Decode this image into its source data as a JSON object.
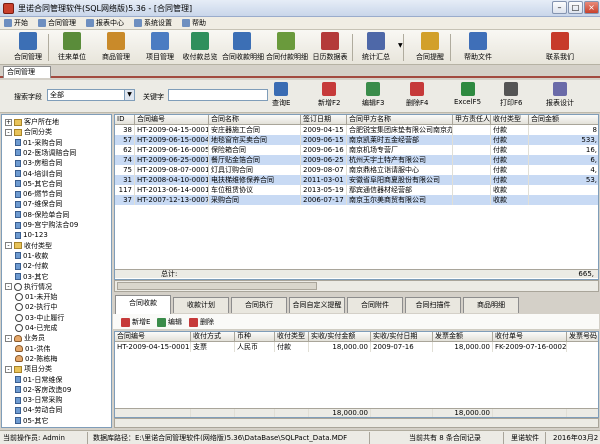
{
  "window": {
    "title": "里诺合同管理软件(SQL网络版)5.36 - [合同管理]",
    "min": "–",
    "max": "□",
    "close": "×"
  },
  "menu": [
    "开始",
    "合同管理",
    "报表中心",
    "系统设置",
    "帮助"
  ],
  "toolbar": [
    {
      "label": "合同管理",
      "color": "#3c6fb5"
    },
    {
      "label": "往来单位",
      "color": "#5a8c3a"
    },
    {
      "label": "商品管理",
      "color": "#c98a2a"
    },
    {
      "label": "项目管理",
      "color": "#4b7cc2"
    },
    {
      "label": "收付款总览",
      "color": "#2f8f5c"
    },
    {
      "label": "合同收款明细",
      "color": "#3c6fb5"
    },
    {
      "label": "合同付款明细",
      "color": "#6a9a3c"
    },
    {
      "label": "日历数据表",
      "color": "#b43a3a"
    },
    {
      "label": "统计汇总",
      "color": "#4e68a8"
    },
    {
      "label": "合同提醒",
      "color": "#d2a02a"
    },
    {
      "label": "帮助文件",
      "color": "#3f6fb8"
    },
    {
      "label": "联系我们",
      "color": "#c73a2a"
    }
  ],
  "doc_tab": "合同管理",
  "search": {
    "field_label": "搜索字段",
    "field_value": "全部",
    "keyword_label": "关键字",
    "keyword_value": "",
    "buttons": [
      {
        "label": "查询E",
        "color": "#3a6cb3"
      },
      {
        "label": "新增F2",
        "color": "#c63a3a"
      },
      {
        "label": "编辑F3",
        "color": "#3a8c4a"
      },
      {
        "label": "删除F4",
        "color": "#c63a3a"
      },
      {
        "label": "ExcelF5",
        "color": "#2e8a40"
      },
      {
        "label": "打印F6",
        "color": "#555555"
      },
      {
        "label": "报表设计",
        "color": "#6a6aa8"
      }
    ]
  },
  "tree": [
    {
      "level": 0,
      "expander": "+",
      "label": "客户所在地",
      "kind": "folder"
    },
    {
      "level": 0,
      "expander": "-",
      "label": "合同分类",
      "kind": "folder"
    },
    {
      "level": 1,
      "expander": "",
      "label": "01-采购合同",
      "kind": "leaf"
    },
    {
      "level": 1,
      "expander": "",
      "label": "02-医场调赔合同",
      "kind": "leaf"
    },
    {
      "level": 1,
      "expander": "",
      "label": "03-房租合同",
      "kind": "leaf"
    },
    {
      "level": 1,
      "expander": "",
      "label": "04-培训合同",
      "kind": "leaf"
    },
    {
      "level": 1,
      "expander": "",
      "label": "05-其它合同",
      "kind": "leaf"
    },
    {
      "level": 1,
      "expander": "",
      "label": "06-燃节合同",
      "kind": "leaf"
    },
    {
      "level": 1,
      "expander": "",
      "label": "07-维保合同",
      "kind": "leaf"
    },
    {
      "level": 1,
      "expander": "",
      "label": "08-保险单合同",
      "kind": "leaf"
    },
    {
      "level": 1,
      "expander": "",
      "label": "09-宫宁购法合09",
      "kind": "leaf"
    },
    {
      "level": 1,
      "expander": "",
      "label": "10-123",
      "kind": "leaf"
    },
    {
      "level": 0,
      "expander": "-",
      "label": "收付类型",
      "kind": "folder"
    },
    {
      "level": 1,
      "expander": "",
      "label": "01-收款",
      "kind": "leaf"
    },
    {
      "level": 1,
      "expander": "",
      "label": "02-付款",
      "kind": "leaf"
    },
    {
      "level": 1,
      "expander": "",
      "label": "03-其它",
      "kind": "leaf"
    },
    {
      "level": 0,
      "expander": "-",
      "label": "执行情况",
      "kind": "clock"
    },
    {
      "level": 1,
      "expander": "",
      "label": "01-未开始",
      "kind": "clock"
    },
    {
      "level": 1,
      "expander": "",
      "label": "02-执行中",
      "kind": "clock"
    },
    {
      "level": 1,
      "expander": "",
      "label": "03-中止履行",
      "kind": "clock"
    },
    {
      "level": 1,
      "expander": "",
      "label": "04-已完成",
      "kind": "clock"
    },
    {
      "level": 0,
      "expander": "-",
      "label": "业务员",
      "kind": "person"
    },
    {
      "level": 1,
      "expander": "",
      "label": "01-洪伟",
      "kind": "person"
    },
    {
      "level": 1,
      "expander": "",
      "label": "02-陈栋梅",
      "kind": "person"
    },
    {
      "level": 0,
      "expander": "-",
      "label": "项目分类",
      "kind": "folder"
    },
    {
      "level": 1,
      "expander": "",
      "label": "01-日常维保",
      "kind": "leaf"
    },
    {
      "level": 1,
      "expander": "",
      "label": "02-客房改造09",
      "kind": "leaf"
    },
    {
      "level": 1,
      "expander": "",
      "label": "03-日常采购",
      "kind": "leaf"
    },
    {
      "level": 1,
      "expander": "",
      "label": "04-劳动合同",
      "kind": "leaf"
    },
    {
      "level": 1,
      "expander": "",
      "label": "05-其它",
      "kind": "leaf"
    }
  ],
  "main_table": {
    "columns": [
      "ID",
      "合同编号",
      "合同名称",
      "签订日期",
      "合同甲方名称",
      "甲方责任人",
      "收付类型",
      "合同金额"
    ],
    "rows": [
      [
        "38",
        "HT-2009-04-15-0001",
        "安庄器施工合同",
        "2009-04-15",
        "合肥锐宝集团床垫有限公司南京办事处",
        "",
        "付款",
        "8"
      ],
      [
        "57",
        "HT-2009-06-15-0004",
        "地毯窗帘买卖合同",
        "2009-06-15",
        "南京凯莱时五金经营部",
        "",
        "付款",
        "533,"
      ],
      [
        "62",
        "HT-2009-06-16-0005",
        "保险箱合同",
        "2009-06-16",
        "南京机场专营厂",
        "",
        "付款",
        "16,"
      ],
      [
        "74",
        "HT-2009-06-25-0001",
        "餐厅贴金箔合同",
        "2009-06-25",
        "杭州天宇土特产有限公司",
        "",
        "付款",
        "6,"
      ],
      [
        "75",
        "HT-2009-08-07-0001",
        "灯具订购合同",
        "2009-08-07",
        "南京鼎格立诣请服中心",
        "",
        "付款",
        "4,"
      ],
      [
        "31",
        "HT-2008-04-10-0001",
        "电扶梯维修保养合同",
        "2011-03-01",
        "安徽省阜阳商夏股份有限公司",
        "",
        "付款",
        "53,"
      ],
      [
        "117",
        "HT-2013-06-14-0001",
        "车位租赁协议",
        "2013-05-19",
        "鄢宾通信器材经营部",
        "",
        "收款",
        ""
      ],
      [
        "37",
        "HT-2007-12-13-0007",
        "采购合同",
        "2006-07-17",
        "南京玉尔美商贸有限公司",
        "",
        "收款",
        ""
      ]
    ],
    "total_label": "总计:",
    "total_value": "665,"
  },
  "bottom_tabs": [
    "合同收款",
    "收款计划",
    "合同执行",
    "合同自定义提醒",
    "合同附件",
    "合同扫描件",
    "商品明细"
  ],
  "detail_toolbar": [
    {
      "label": "新增E",
      "color": "#c63a3a"
    },
    {
      "label": "编辑",
      "color": "#3a8c4a"
    },
    {
      "label": "删除",
      "color": "#c63a3a"
    }
  ],
  "detail_table": {
    "columns": [
      "合同编号",
      "收付方式",
      "币种",
      "收付类型",
      "实收/实付金额",
      "实收/实付日期",
      "发票金额",
      "收付单号",
      "发票号码"
    ],
    "rows": [
      [
        "HT-2009-04-15-0001",
        "支票",
        "人民币",
        "付款",
        "18,000.00",
        "2009-07-16",
        "18,000.00",
        "FK-2009-07-16-0002",
        ""
      ]
    ],
    "totals": [
      "",
      "",
      "",
      "",
      "18,000.00",
      "",
      "18,000.00",
      "",
      ""
    ]
  },
  "status": {
    "operator": "当前操作员: Admin",
    "db_path": "数据库路径：E:\\里诺合同管理软件(网络版)5.36\\DataBase\\SQLPact_Data.MDF",
    "record_count": "当前共有 8 条合同记录",
    "company": "里诺软件",
    "date": "2016年03月2"
  }
}
